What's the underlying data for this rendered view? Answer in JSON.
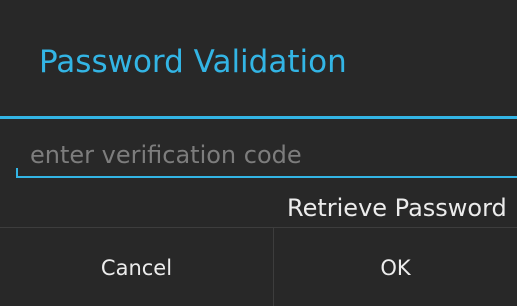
{
  "dialog": {
    "title": "Password Validation",
    "code_input": {
      "placeholder": "enter verification code",
      "value": ""
    },
    "retrieve_link": "Retrieve Password",
    "buttons": {
      "cancel": "Cancel",
      "ok": "OK"
    }
  },
  "colors": {
    "accent": "#33b5e5",
    "dialog_background": "#282828",
    "page_background": "#ffffff",
    "text": "#ececec",
    "hint_text": "#7d7d7d"
  }
}
